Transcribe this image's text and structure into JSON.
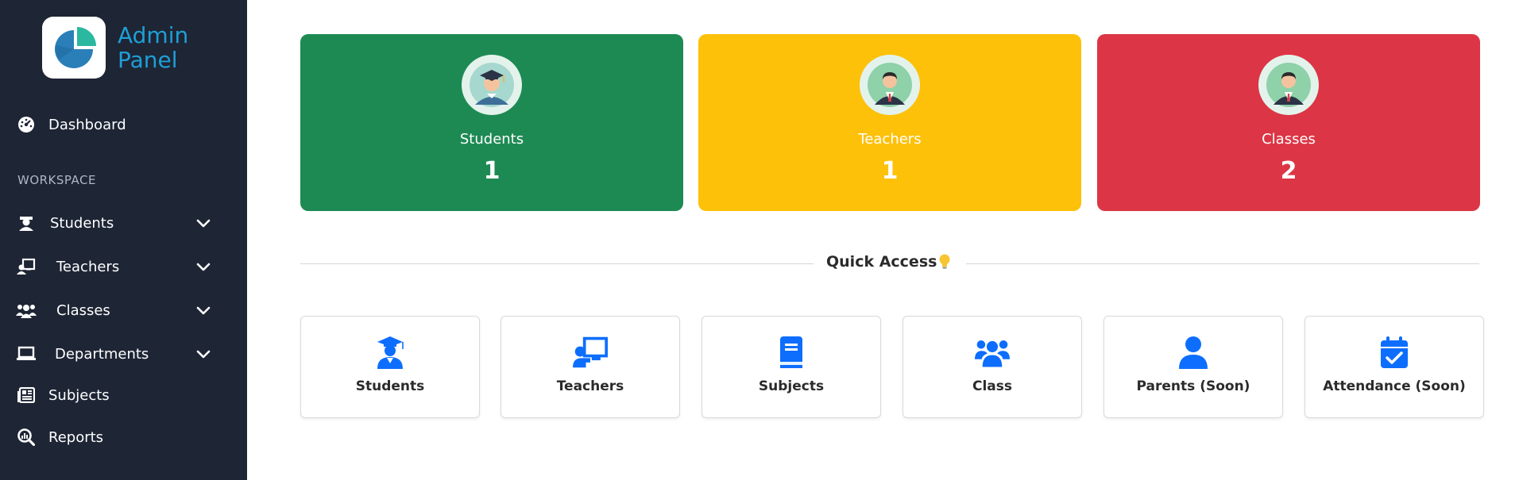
{
  "brand": {
    "line1": "Admin",
    "line2": "Panel"
  },
  "sidebar": {
    "dashboard": "Dashboard",
    "section_title": "WORKSPACE",
    "items": [
      {
        "label": "Students",
        "icon": "student-icon",
        "expandable": true
      },
      {
        "label": "Teachers",
        "icon": "teacher-icon",
        "expandable": true
      },
      {
        "label": "Classes",
        "icon": "users-icon",
        "expandable": true
      },
      {
        "label": "Departments",
        "icon": "laptop-icon",
        "expandable": true
      },
      {
        "label": "Subjects",
        "icon": "newspaper-icon",
        "expandable": false
      },
      {
        "label": "Reports",
        "icon": "search-chart-icon",
        "expandable": false
      }
    ]
  },
  "stats": [
    {
      "label": "Students",
      "value": "1",
      "color": "#1d8a54"
    },
    {
      "label": "Teachers",
      "value": "1",
      "color": "#fdc10a"
    },
    {
      "label": "Classes",
      "value": "2",
      "color": "#dc3545"
    }
  ],
  "quick_access": {
    "title": "Quick Access",
    "accent": "#0d6efd",
    "items": [
      {
        "label": "Students",
        "icon": "graduate-icon"
      },
      {
        "label": "Teachers",
        "icon": "chalkboard-teacher-icon"
      },
      {
        "label": "Subjects",
        "icon": "book-icon"
      },
      {
        "label": "Class",
        "icon": "users-icon"
      },
      {
        "label": "Parents (Soon)",
        "icon": "user-icon"
      },
      {
        "label": "Attendance (Soon)",
        "icon": "calendar-check-icon"
      }
    ]
  }
}
